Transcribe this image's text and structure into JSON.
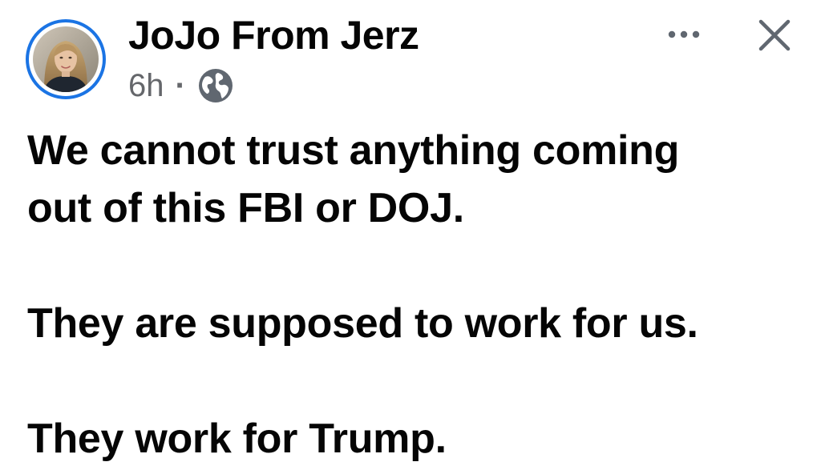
{
  "post": {
    "author_name": "JoJo From Jerz",
    "timestamp": "6h",
    "separator": "·",
    "audience_icon": "globe-icon",
    "header_actions": {
      "more_icon": "more-options-icon",
      "close_icon": "close-icon"
    },
    "paragraphs": [
      {
        "lines": [
          "We cannot trust anything coming",
          "out of this FBI or DOJ."
        ]
      },
      {
        "lines": [
          "They are supposed to work for us."
        ]
      },
      {
        "lines": [
          "They work for Trump."
        ]
      }
    ]
  },
  "colors": {
    "avatar_ring": "#1b74e4",
    "meta_text": "#65676b",
    "body_text": "#050505",
    "icon_gray": "#606770"
  }
}
